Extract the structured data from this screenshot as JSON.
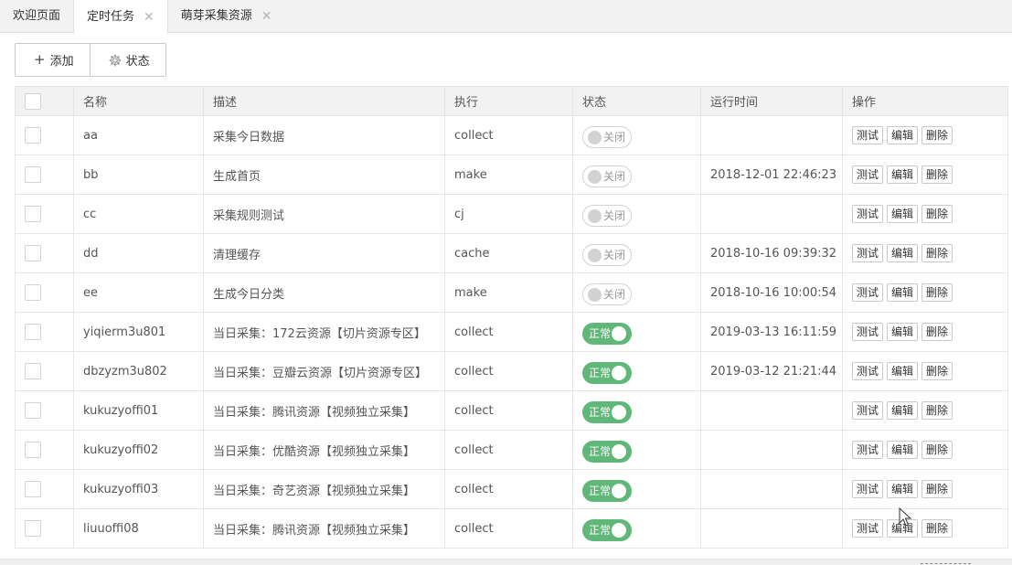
{
  "tabs": [
    {
      "label": "欢迎页面",
      "closable": false,
      "active": false
    },
    {
      "label": "定时任务",
      "closable": true,
      "active": true
    },
    {
      "label": "萌芽采集资源",
      "closable": true,
      "active": false
    }
  ],
  "toolbar": {
    "add_label": "添加",
    "status_label": "状态"
  },
  "table": {
    "headers": {
      "name": "名称",
      "desc": "描述",
      "exec": "执行",
      "status": "状态",
      "runtime": "运行时间",
      "ops": "操作"
    },
    "switch_off_label": "关闭",
    "switch_on_label": "正常",
    "actions": {
      "test": "测试",
      "edit": "编辑",
      "delete": "删除"
    },
    "rows": [
      {
        "name": "aa",
        "desc": "采集今日数据",
        "exec": "collect",
        "status": "off",
        "runtime": ""
      },
      {
        "name": "bb",
        "desc": "生成首页",
        "exec": "make",
        "status": "off",
        "runtime": "2018-12-01 22:46:23"
      },
      {
        "name": "cc",
        "desc": "采集规则测试",
        "exec": "cj",
        "status": "off",
        "runtime": ""
      },
      {
        "name": "dd",
        "desc": "清理缓存",
        "exec": "cache",
        "status": "off",
        "runtime": "2018-10-16 09:39:32"
      },
      {
        "name": "ee",
        "desc": "生成今日分类",
        "exec": "make",
        "status": "off",
        "runtime": "2018-10-16 10:00:54"
      },
      {
        "name": "yiqierm3u801",
        "desc": "当日采集：172云资源【切片资源专区】",
        "exec": "collect",
        "status": "on",
        "runtime": "2019-03-13 16:11:59"
      },
      {
        "name": "dbzyzm3u802",
        "desc": "当日采集：豆瓣云资源【切片资源专区】",
        "exec": "collect",
        "status": "on",
        "runtime": "2019-03-12 21:21:44"
      },
      {
        "name": "kukuzyoffi01",
        "desc": "当日采集：腾讯资源【视频独立采集】",
        "exec": "collect",
        "status": "on",
        "runtime": ""
      },
      {
        "name": "kukuzyoffi02",
        "desc": "当日采集：优酷资源【视频独立采集】",
        "exec": "collect",
        "status": "on",
        "runtime": ""
      },
      {
        "name": "kukuzyoffi03",
        "desc": "当日采集：奇艺资源【视频独立采集】",
        "exec": "collect",
        "status": "on",
        "runtime": ""
      },
      {
        "name": "liuuoffi08",
        "desc": "当日采集：腾讯资源【视频独立采集】",
        "exec": "collect",
        "status": "on",
        "runtime": ""
      }
    ]
  },
  "colors": {
    "switch_on": "#5fb878",
    "switch_off_border": "#d2d2d2",
    "header_bg": "#f2f2f2"
  }
}
